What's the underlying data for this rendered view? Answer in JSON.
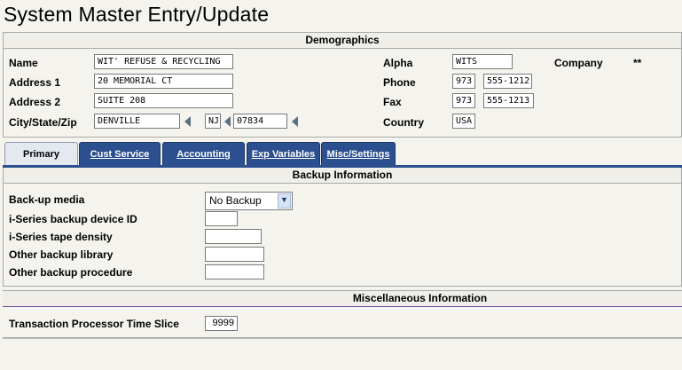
{
  "title": "System Master Entry/Update",
  "demographics": {
    "header": "Demographics",
    "name_label": "Name",
    "name_value": "WIT' REFUSE & RECYCLING",
    "address1_label": "Address 1",
    "address1_value": "20 MEMORIAL CT",
    "address2_label": "Address 2",
    "address2_value": "SUITE 208",
    "csz_label": "City/State/Zip",
    "city_value": "DENVILLE",
    "state_value": "NJ",
    "zip_value": "07834",
    "alpha_label": "Alpha",
    "alpha_value": "WITS",
    "company_label": "Company",
    "company_value": "**",
    "phone_label": "Phone",
    "phone_area": "973",
    "phone_number": "555-1212",
    "fax_label": "Fax",
    "fax_area": "973",
    "fax_number": "555-1213",
    "country_label": "Country",
    "country_value": "USA"
  },
  "tabs": [
    "Primary",
    "Cust Service",
    "Accounting",
    "Exp Variables",
    "Misc/Settings"
  ],
  "backup": {
    "header": "Backup Information",
    "media_label": "Back-up media",
    "media_selected": "No Backup",
    "device_label": "i-Series backup device ID",
    "device_value": "",
    "density_label": "i-Series tape density",
    "density_value": "",
    "library_label": "Other backup library",
    "library_value": "",
    "procedure_label": "Other backup procedure",
    "procedure_value": ""
  },
  "misc": {
    "header": "Miscellaneous Information",
    "slice_label": "Transaction Processor Time Slice",
    "slice_value": "9999"
  },
  "colors": {
    "tab": "#2b4f8f",
    "tab_active": "#e4e9f0"
  }
}
